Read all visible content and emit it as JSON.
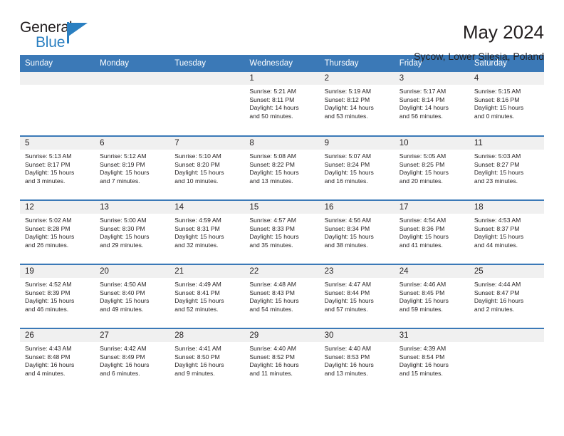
{
  "logo": {
    "word_one": "General",
    "word_two": "Blue",
    "flag_icon": "triangle-flag-icon",
    "accent_color": "#2a7fc1"
  },
  "header": {
    "title": "May 2024",
    "subtitle": "Sycow, Lower Silesia, Poland",
    "header_bg_color": "#3b79b7",
    "daynum_bg_color": "#f0f0f0"
  },
  "weekdays": [
    "Sunday",
    "Monday",
    "Tuesday",
    "Wednesday",
    "Thursday",
    "Friday",
    "Saturday"
  ],
  "weeks": [
    [
      {
        "day": "",
        "lines": []
      },
      {
        "day": "",
        "lines": []
      },
      {
        "day": "",
        "lines": []
      },
      {
        "day": "1",
        "lines": [
          "Sunrise: 5:21 AM",
          "Sunset: 8:11 PM",
          "Daylight: 14 hours",
          "and 50 minutes."
        ]
      },
      {
        "day": "2",
        "lines": [
          "Sunrise: 5:19 AM",
          "Sunset: 8:12 PM",
          "Daylight: 14 hours",
          "and 53 minutes."
        ]
      },
      {
        "day": "3",
        "lines": [
          "Sunrise: 5:17 AM",
          "Sunset: 8:14 PM",
          "Daylight: 14 hours",
          "and 56 minutes."
        ]
      },
      {
        "day": "4",
        "lines": [
          "Sunrise: 5:15 AM",
          "Sunset: 8:16 PM",
          "Daylight: 15 hours",
          "and 0 minutes."
        ]
      }
    ],
    [
      {
        "day": "5",
        "lines": [
          "Sunrise: 5:13 AM",
          "Sunset: 8:17 PM",
          "Daylight: 15 hours",
          "and 3 minutes."
        ]
      },
      {
        "day": "6",
        "lines": [
          "Sunrise: 5:12 AM",
          "Sunset: 8:19 PM",
          "Daylight: 15 hours",
          "and 7 minutes."
        ]
      },
      {
        "day": "7",
        "lines": [
          "Sunrise: 5:10 AM",
          "Sunset: 8:20 PM",
          "Daylight: 15 hours",
          "and 10 minutes."
        ]
      },
      {
        "day": "8",
        "lines": [
          "Sunrise: 5:08 AM",
          "Sunset: 8:22 PM",
          "Daylight: 15 hours",
          "and 13 minutes."
        ]
      },
      {
        "day": "9",
        "lines": [
          "Sunrise: 5:07 AM",
          "Sunset: 8:24 PM",
          "Daylight: 15 hours",
          "and 16 minutes."
        ]
      },
      {
        "day": "10",
        "lines": [
          "Sunrise: 5:05 AM",
          "Sunset: 8:25 PM",
          "Daylight: 15 hours",
          "and 20 minutes."
        ]
      },
      {
        "day": "11",
        "lines": [
          "Sunrise: 5:03 AM",
          "Sunset: 8:27 PM",
          "Daylight: 15 hours",
          "and 23 minutes."
        ]
      }
    ],
    [
      {
        "day": "12",
        "lines": [
          "Sunrise: 5:02 AM",
          "Sunset: 8:28 PM",
          "Daylight: 15 hours",
          "and 26 minutes."
        ]
      },
      {
        "day": "13",
        "lines": [
          "Sunrise: 5:00 AM",
          "Sunset: 8:30 PM",
          "Daylight: 15 hours",
          "and 29 minutes."
        ]
      },
      {
        "day": "14",
        "lines": [
          "Sunrise: 4:59 AM",
          "Sunset: 8:31 PM",
          "Daylight: 15 hours",
          "and 32 minutes."
        ]
      },
      {
        "day": "15",
        "lines": [
          "Sunrise: 4:57 AM",
          "Sunset: 8:33 PM",
          "Daylight: 15 hours",
          "and 35 minutes."
        ]
      },
      {
        "day": "16",
        "lines": [
          "Sunrise: 4:56 AM",
          "Sunset: 8:34 PM",
          "Daylight: 15 hours",
          "and 38 minutes."
        ]
      },
      {
        "day": "17",
        "lines": [
          "Sunrise: 4:54 AM",
          "Sunset: 8:36 PM",
          "Daylight: 15 hours",
          "and 41 minutes."
        ]
      },
      {
        "day": "18",
        "lines": [
          "Sunrise: 4:53 AM",
          "Sunset: 8:37 PM",
          "Daylight: 15 hours",
          "and 44 minutes."
        ]
      }
    ],
    [
      {
        "day": "19",
        "lines": [
          "Sunrise: 4:52 AM",
          "Sunset: 8:39 PM",
          "Daylight: 15 hours",
          "and 46 minutes."
        ]
      },
      {
        "day": "20",
        "lines": [
          "Sunrise: 4:50 AM",
          "Sunset: 8:40 PM",
          "Daylight: 15 hours",
          "and 49 minutes."
        ]
      },
      {
        "day": "21",
        "lines": [
          "Sunrise: 4:49 AM",
          "Sunset: 8:41 PM",
          "Daylight: 15 hours",
          "and 52 minutes."
        ]
      },
      {
        "day": "22",
        "lines": [
          "Sunrise: 4:48 AM",
          "Sunset: 8:43 PM",
          "Daylight: 15 hours",
          "and 54 minutes."
        ]
      },
      {
        "day": "23",
        "lines": [
          "Sunrise: 4:47 AM",
          "Sunset: 8:44 PM",
          "Daylight: 15 hours",
          "and 57 minutes."
        ]
      },
      {
        "day": "24",
        "lines": [
          "Sunrise: 4:46 AM",
          "Sunset: 8:45 PM",
          "Daylight: 15 hours",
          "and 59 minutes."
        ]
      },
      {
        "day": "25",
        "lines": [
          "Sunrise: 4:44 AM",
          "Sunset: 8:47 PM",
          "Daylight: 16 hours",
          "and 2 minutes."
        ]
      }
    ],
    [
      {
        "day": "26",
        "lines": [
          "Sunrise: 4:43 AM",
          "Sunset: 8:48 PM",
          "Daylight: 16 hours",
          "and 4 minutes."
        ]
      },
      {
        "day": "27",
        "lines": [
          "Sunrise: 4:42 AM",
          "Sunset: 8:49 PM",
          "Daylight: 16 hours",
          "and 6 minutes."
        ]
      },
      {
        "day": "28",
        "lines": [
          "Sunrise: 4:41 AM",
          "Sunset: 8:50 PM",
          "Daylight: 16 hours",
          "and 9 minutes."
        ]
      },
      {
        "day": "29",
        "lines": [
          "Sunrise: 4:40 AM",
          "Sunset: 8:52 PM",
          "Daylight: 16 hours",
          "and 11 minutes."
        ]
      },
      {
        "day": "30",
        "lines": [
          "Sunrise: 4:40 AM",
          "Sunset: 8:53 PM",
          "Daylight: 16 hours",
          "and 13 minutes."
        ]
      },
      {
        "day": "31",
        "lines": [
          "Sunrise: 4:39 AM",
          "Sunset: 8:54 PM",
          "Daylight: 16 hours",
          "and 15 minutes."
        ]
      },
      {
        "day": "",
        "lines": []
      }
    ]
  ]
}
